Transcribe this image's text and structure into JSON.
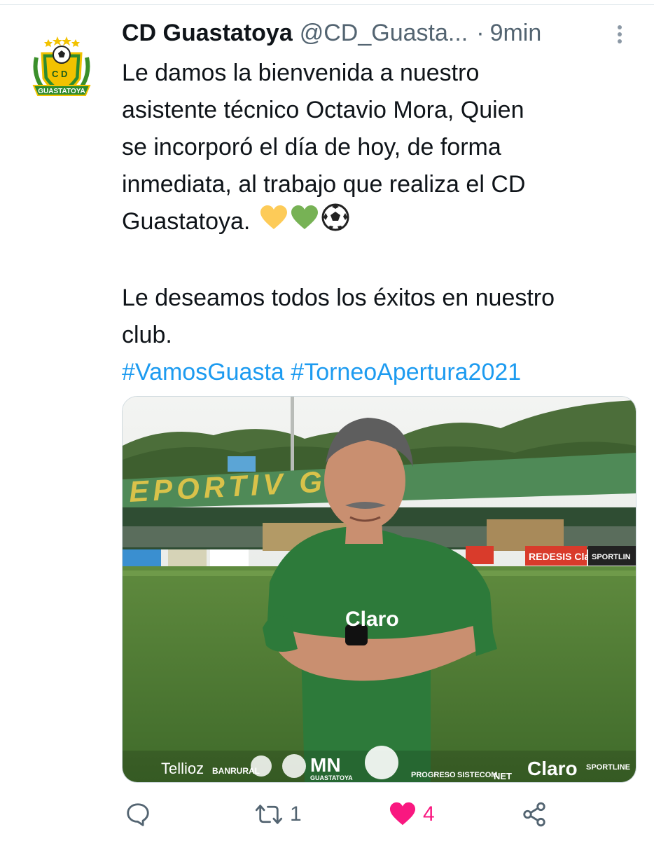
{
  "tweet": {
    "author_name": "CD Guastatoya",
    "handle": "@CD_Guasta...",
    "separator": "·",
    "time": "9min",
    "text_lines": [
      "Le damos la bienvenida a nuestro",
      "asistente técnico Octavio Mora,  Quien",
      "se incorporó el día de hoy, de forma",
      "inmediata, al trabajo que realiza el CD",
      "Guastatoya."
    ],
    "emojis": [
      "yellow-heart",
      "green-heart",
      "soccer-ball"
    ],
    "text2_lines": [
      "Le deseamos todos los éxitos en nuestro",
      "club."
    ],
    "hashtags": [
      "#VamosGuasta",
      "#TorneoApertura2021"
    ]
  },
  "avatar": {
    "logo_text_top": "C D",
    "logo_text_banner": "GUASTATOYA"
  },
  "media": {
    "stadium_sign": "EPORTIV GUAS",
    "ad_board_1": "REDESIS Claro",
    "ad_board_2": "SPORTLIN",
    "shirt_sponsor": "Claro",
    "sponsors": [
      "Tellioz",
      "BANRURAL",
      "MN",
      "GUASTATOYA",
      "PROGRESO",
      "SISTECOM",
      "NET",
      "Claro",
      "SPORTLINE"
    ]
  },
  "actions": {
    "reply_count": "",
    "retweet_count": "1",
    "like_count": "4"
  },
  "colors": {
    "link": "#1d9bf0",
    "like": "#f91880",
    "secondary": "#536471"
  }
}
